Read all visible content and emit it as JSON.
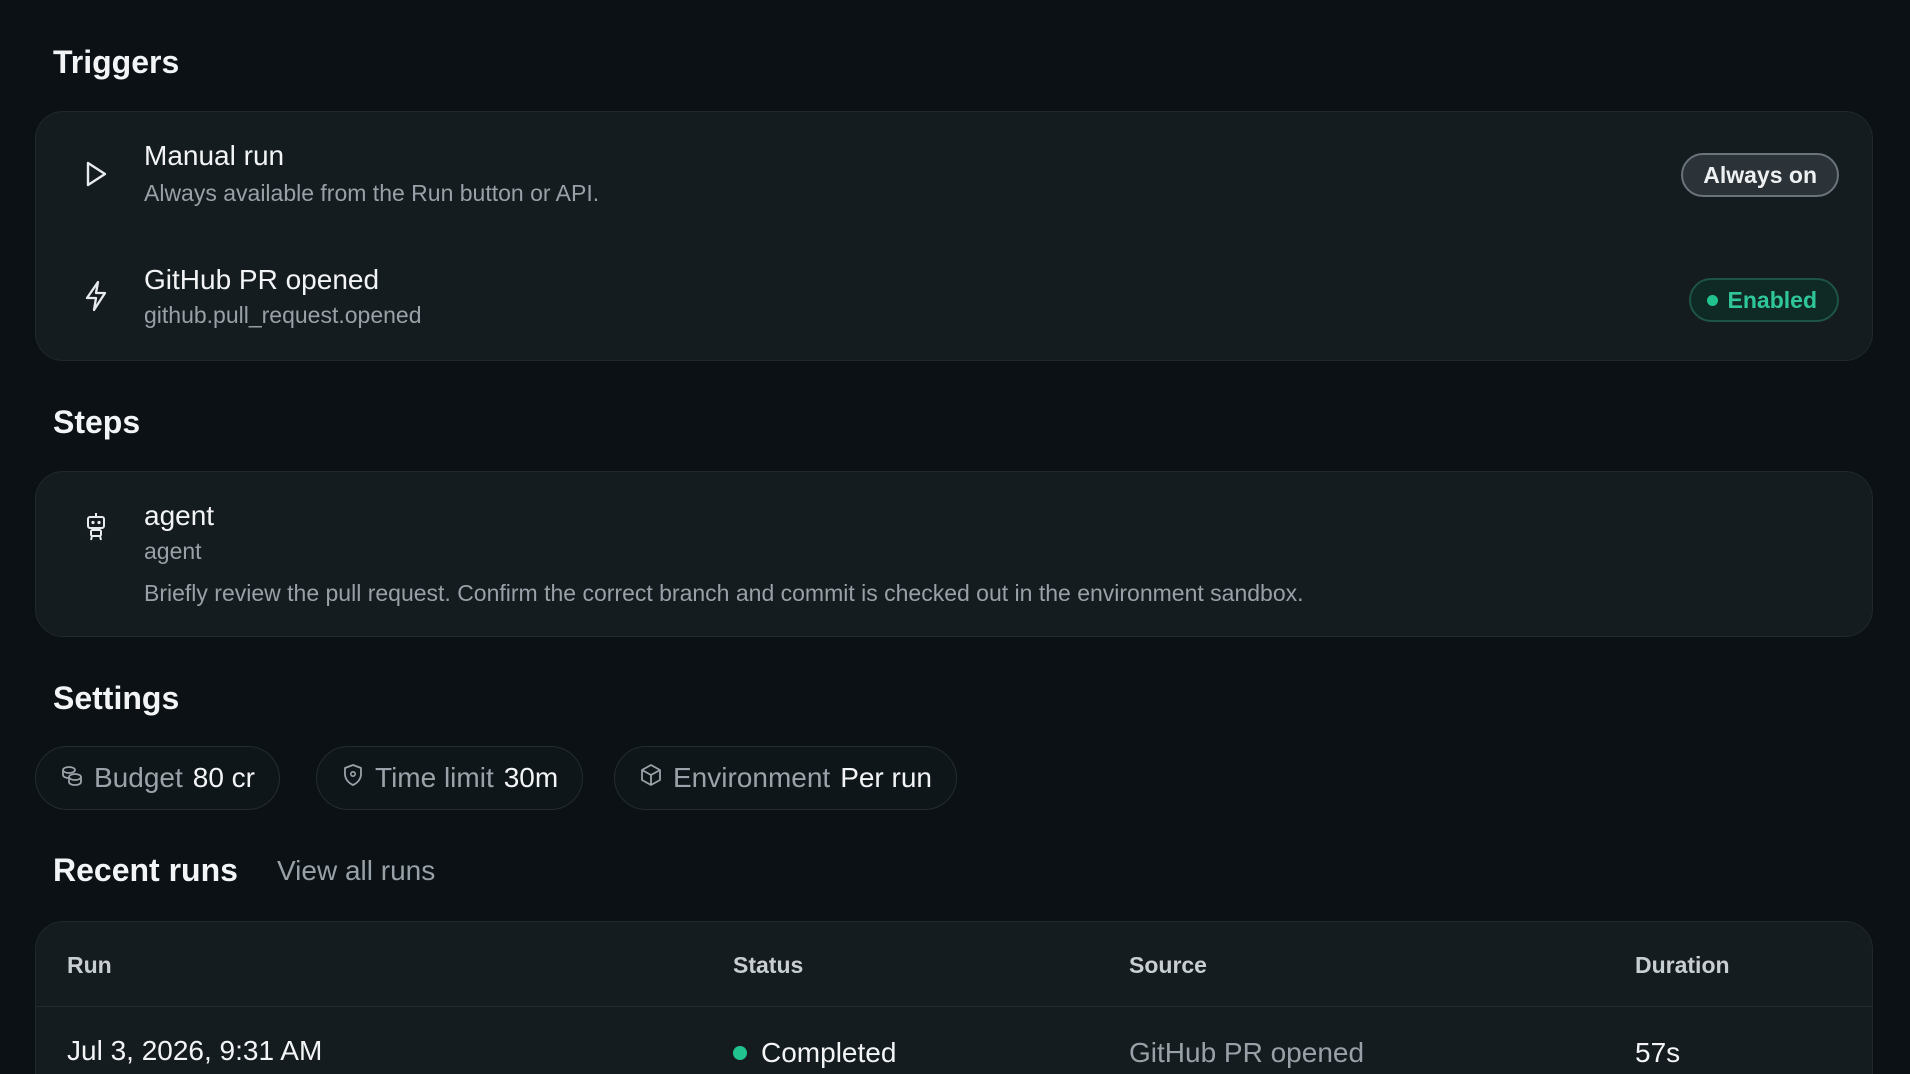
{
  "triggers": {
    "title": "Triggers",
    "items": [
      {
        "title": "Manual run",
        "subtitle": "Always available from the Run button or API.",
        "badge": "Always on",
        "icon": "play-icon"
      },
      {
        "title": "GitHub PR opened",
        "subtitle": "github.pull_request.opened",
        "badge": "Enabled",
        "icon": "lightning-icon"
      }
    ]
  },
  "steps": {
    "title": "Steps",
    "items": [
      {
        "title": "agent",
        "type": "agent",
        "description": "Briefly review the pull request. Confirm the correct branch and commit is checked out in the environment sandbox.",
        "icon": "robot-icon"
      }
    ]
  },
  "settings": {
    "title": "Settings",
    "budget": {
      "label": "Budget",
      "value": "80 cr",
      "icon": "coins-icon"
    },
    "time_limit": {
      "label": "Time limit",
      "value": "30m",
      "icon": "shield-icon"
    },
    "environment": {
      "label": "Environment",
      "value": "Per run",
      "icon": "cube-icon"
    }
  },
  "recent_runs": {
    "title": "Recent runs",
    "view_all": "View all runs",
    "columns": {
      "run": "Run",
      "status": "Status",
      "source": "Source",
      "duration": "Duration"
    },
    "rows": [
      {
        "run": "Jul 3, 2026, 9:31 AM",
        "status": "Completed",
        "source": "GitHub PR opened",
        "duration": "57s"
      }
    ]
  },
  "colors": {
    "background": "#0b1115",
    "card": "#151c20",
    "accent_green": "#22c28f"
  }
}
